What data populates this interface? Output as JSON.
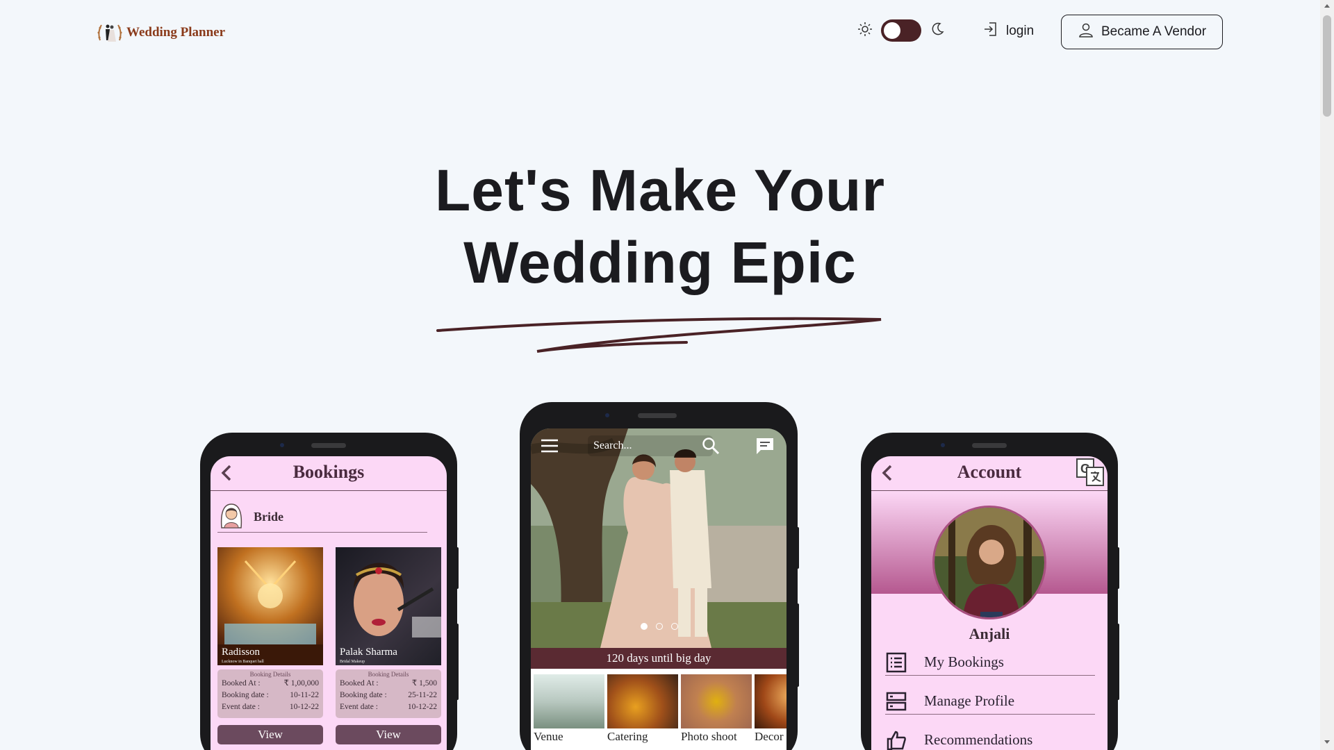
{
  "nav": {
    "logo_text": "Wedding Planner",
    "login_label": "login",
    "vendor_label": "Became A Vendor"
  },
  "hero": {
    "title_line1": "Let's Make Your",
    "title_line2": "Wedding Epic"
  },
  "bookings_screen": {
    "title": "Bookings",
    "section": "Bride",
    "cards": [
      {
        "name": "Radisson",
        "sub": "Lucknow in Banquet hall",
        "details_title": "Booking Details",
        "booked_at_label": "Booked At :",
        "booked_at": "₹ 1,00,000",
        "booking_date_label": "Booking date :",
        "booking_date": "10-11-22",
        "event_date_label": "Event date :",
        "event_date": "10-12-22",
        "button": "View"
      },
      {
        "name": "Palak Sharma",
        "sub": "Bridal Makeup",
        "details_title": "Booking Details",
        "booked_at_label": "Booked At :",
        "booked_at": "₹ 1,500",
        "booking_date_label": "Booking date :",
        "booking_date": "25-11-22",
        "event_date_label": "Event date :",
        "event_date": "10-12-22",
        "button": "View"
      }
    ]
  },
  "home_screen": {
    "search_placeholder": "Search...",
    "countdown": "120 days until big day",
    "categories": [
      "Venue",
      "Catering",
      "Photo shoot",
      "Decor"
    ]
  },
  "account_screen": {
    "title": "Account",
    "name": "Anjali",
    "menu": [
      "My Bookings",
      "Manage Profile",
      "Recommendations"
    ]
  },
  "colors": {
    "brand": "#8a3a1a",
    "toggle": "#4a2226",
    "screen_pink": "#fcd8f6",
    "plum": "#6b4a5e"
  }
}
